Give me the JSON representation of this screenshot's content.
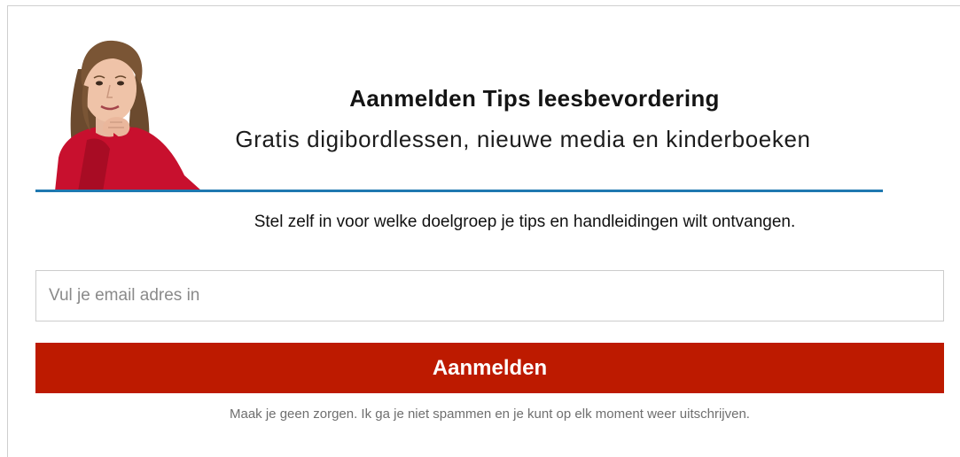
{
  "header": {
    "title": "Aanmelden Tips leesbevordering",
    "subtitle": "Gratis digibordlessen, nieuwe media en kinderboeken"
  },
  "intro": {
    "text": "Stel zelf in voor welke doelgroep je tips en handleidingen wilt ontvangen."
  },
  "form": {
    "email_placeholder": "Vul je email adres in",
    "email_value": "",
    "submit_label": "Aanmelden",
    "disclaimer": "Maak je geen zorgen. Ik ga je niet spammen en je kunt op elk moment weer uitschrijven."
  },
  "colors": {
    "accent_line": "#1f78b0",
    "button": "#bd1a00",
    "button_text": "#ffffff"
  },
  "portrait": {
    "icon": "author-portrait"
  }
}
